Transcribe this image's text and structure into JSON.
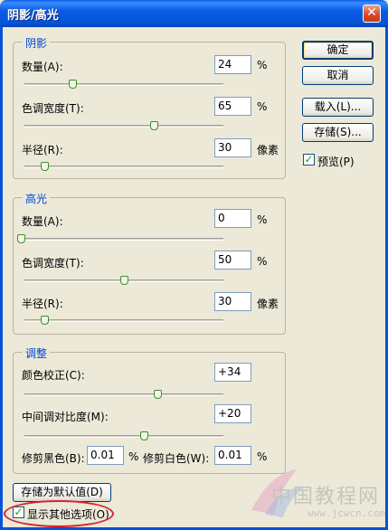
{
  "window": {
    "title": "阴影/高光",
    "close_glyph": "✕"
  },
  "shadows": {
    "title": "阴影",
    "amount": {
      "label": "数量(A):",
      "value": "24",
      "unit": "%",
      "slider": 24
    },
    "tonal_width": {
      "label": "色调宽度(T):",
      "value": "65",
      "unit": "%",
      "slider": 65
    },
    "radius": {
      "label": "半径(R):",
      "value": "30",
      "unit": "像素",
      "slider": 30
    }
  },
  "highlights": {
    "title": "高光",
    "amount": {
      "label": "数量(A):",
      "value": "0",
      "unit": "%",
      "slider": 0
    },
    "tonal_width": {
      "label": "色调宽度(T):",
      "value": "50",
      "unit": "%",
      "slider": 50
    },
    "radius": {
      "label": "半径(R):",
      "value": "30",
      "unit": "像素",
      "slider": 30
    }
  },
  "adjustments": {
    "title": "调整",
    "color_correction": {
      "label": "颜色校正(C):",
      "value": "+34",
      "slider": 0.67
    },
    "midtone_contrast": {
      "label": "中间调对比度(M):",
      "value": "+20",
      "slider": 0.6
    },
    "black_clip": {
      "label": "修剪黑色(B):",
      "value": "0.01",
      "unit": "%"
    },
    "white_clip": {
      "label": "修剪白色(W):",
      "value": "0.01",
      "unit": "%"
    }
  },
  "buttons": {
    "ok": "确定",
    "cancel": "取消",
    "load": "载入(L)...",
    "save": "存储(S)...",
    "save_default": "存储为默认值(D)"
  },
  "preview": {
    "label": "预览(P)",
    "checked": true
  },
  "show_more": {
    "label": "显示其他选项(O)",
    "checked": true
  },
  "watermark": {
    "text": "中国教程网",
    "url": "www.jcwcn.com"
  },
  "colors": {
    "group_title": "#0046d5",
    "title_bar": "#0653d8",
    "highlight_ring": "#d8232a"
  }
}
